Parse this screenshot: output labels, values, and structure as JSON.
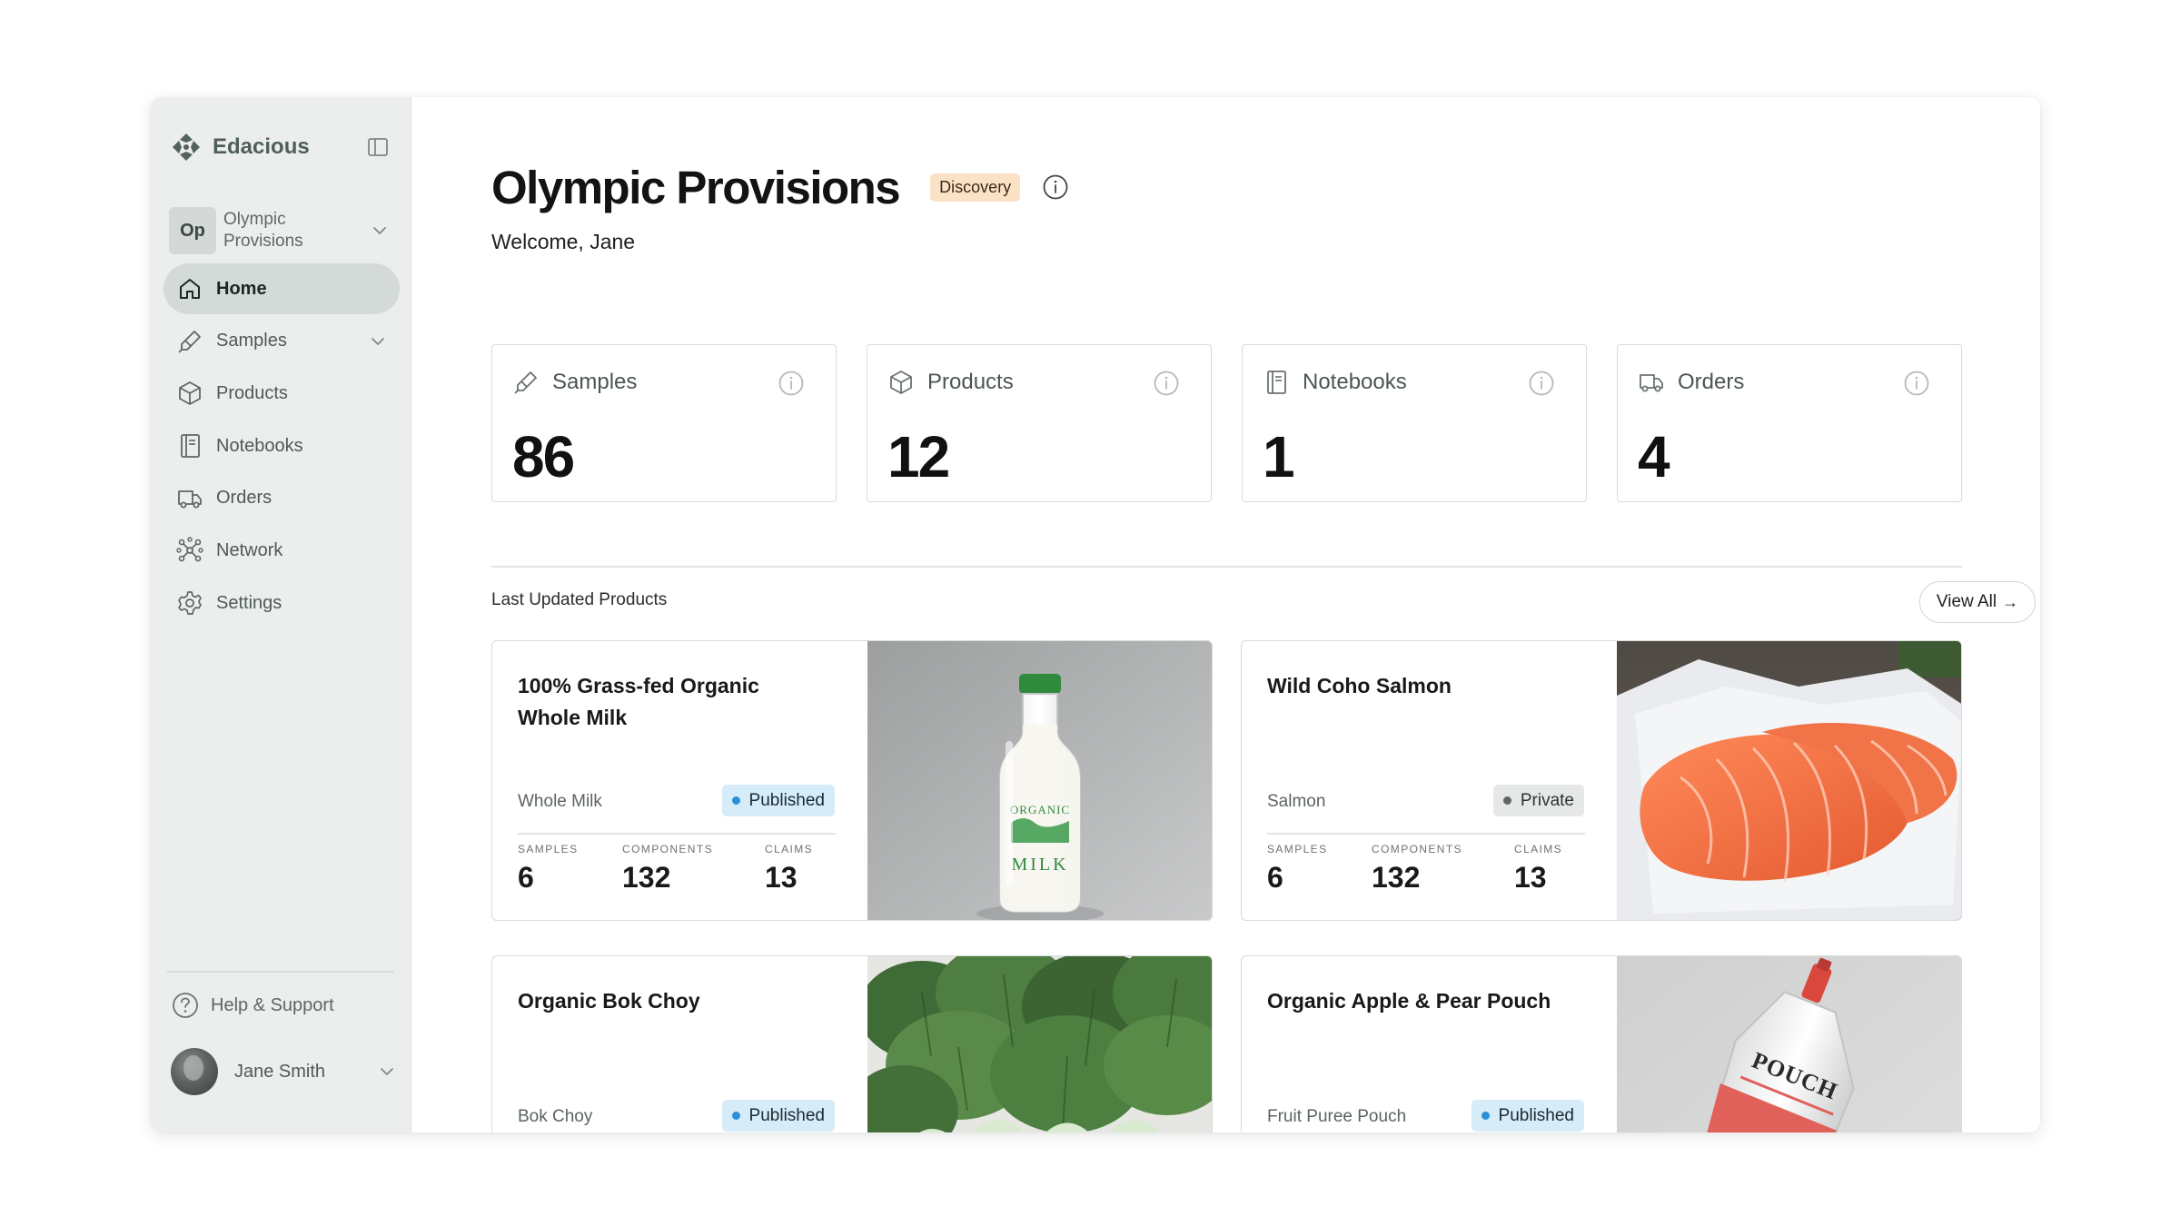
{
  "sidebar": {
    "brand": "Edacious",
    "org": {
      "initials": "Op",
      "name": "Olympic Provisions"
    },
    "nav": [
      {
        "label": "Home",
        "icon": "home-icon",
        "active": true
      },
      {
        "label": "Samples",
        "icon": "samples-icon",
        "expandable": true
      },
      {
        "label": "Products",
        "icon": "products-icon"
      },
      {
        "label": "Notebooks",
        "icon": "notebooks-icon"
      },
      {
        "label": "Orders",
        "icon": "orders-icon"
      },
      {
        "label": "Network",
        "icon": "network-icon"
      },
      {
        "label": "Settings",
        "icon": "settings-icon"
      }
    ],
    "help_label": "Help & Support",
    "user_name": "Jane Smith"
  },
  "header": {
    "title": "Olympic Provisions",
    "tier_badge": "Discovery",
    "welcome": "Welcome, Jane"
  },
  "stats": [
    {
      "label": "Samples",
      "value": "86",
      "icon": "samples-icon"
    },
    {
      "label": "Products",
      "value": "12",
      "icon": "products-icon"
    },
    {
      "label": "Notebooks",
      "value": "1",
      "icon": "notebooks-icon"
    },
    {
      "label": "Orders",
      "value": "4",
      "icon": "orders-icon"
    }
  ],
  "products_section": {
    "title": "Last Updated Products",
    "view_all": "View All",
    "metric_labels": {
      "samples": "SAMPLES",
      "components": "COMPONENTS",
      "claims": "CLAIMS"
    },
    "items": [
      {
        "title": "100% Grass-fed Organic Whole Milk",
        "category": "Whole Milk",
        "status": "Published",
        "samples": "6",
        "components": "132",
        "claims": "13",
        "image": "milk-bottle",
        "bottle_label_top": "ORGANIC",
        "bottle_label_bottom": "MILK"
      },
      {
        "title": "Wild Coho Salmon",
        "category": "Salmon",
        "status": "Private",
        "samples": "6",
        "components": "132",
        "claims": "13",
        "image": "salmon-fillet"
      },
      {
        "title": "Organic Bok Choy",
        "category": "Bok Choy",
        "status": "Published",
        "image": "bok-choy"
      },
      {
        "title": "Organic Apple & Pear Pouch",
        "category": "Fruit Puree Pouch",
        "status": "Published",
        "image": "puree-pouch",
        "pouch_label": "POUCH"
      }
    ]
  },
  "colors": {
    "sidebar_bg": "#eceeed",
    "active_nav": "#d3dad8",
    "tier_badge": "#fbe2c7",
    "published_badge": "#d6ecf9",
    "published_dot": "#2b8fd6",
    "private_badge": "#e6e8e7"
  }
}
